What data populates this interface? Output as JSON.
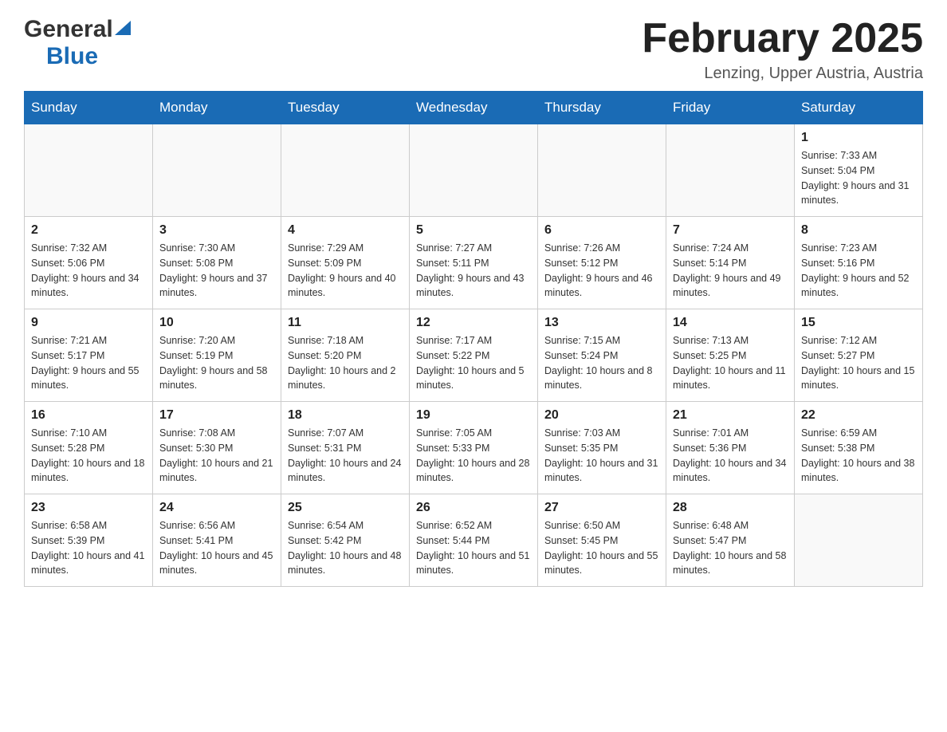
{
  "header": {
    "logo_general": "General",
    "logo_blue": "Blue",
    "month_title": "February 2025",
    "location": "Lenzing, Upper Austria, Austria"
  },
  "weekdays": [
    "Sunday",
    "Monday",
    "Tuesday",
    "Wednesday",
    "Thursday",
    "Friday",
    "Saturday"
  ],
  "weeks": [
    [
      {
        "day": "",
        "info": ""
      },
      {
        "day": "",
        "info": ""
      },
      {
        "day": "",
        "info": ""
      },
      {
        "day": "",
        "info": ""
      },
      {
        "day": "",
        "info": ""
      },
      {
        "day": "",
        "info": ""
      },
      {
        "day": "1",
        "info": "Sunrise: 7:33 AM\nSunset: 5:04 PM\nDaylight: 9 hours and 31 minutes."
      }
    ],
    [
      {
        "day": "2",
        "info": "Sunrise: 7:32 AM\nSunset: 5:06 PM\nDaylight: 9 hours and 34 minutes."
      },
      {
        "day": "3",
        "info": "Sunrise: 7:30 AM\nSunset: 5:08 PM\nDaylight: 9 hours and 37 minutes."
      },
      {
        "day": "4",
        "info": "Sunrise: 7:29 AM\nSunset: 5:09 PM\nDaylight: 9 hours and 40 minutes."
      },
      {
        "day": "5",
        "info": "Sunrise: 7:27 AM\nSunset: 5:11 PM\nDaylight: 9 hours and 43 minutes."
      },
      {
        "day": "6",
        "info": "Sunrise: 7:26 AM\nSunset: 5:12 PM\nDaylight: 9 hours and 46 minutes."
      },
      {
        "day": "7",
        "info": "Sunrise: 7:24 AM\nSunset: 5:14 PM\nDaylight: 9 hours and 49 minutes."
      },
      {
        "day": "8",
        "info": "Sunrise: 7:23 AM\nSunset: 5:16 PM\nDaylight: 9 hours and 52 minutes."
      }
    ],
    [
      {
        "day": "9",
        "info": "Sunrise: 7:21 AM\nSunset: 5:17 PM\nDaylight: 9 hours and 55 minutes."
      },
      {
        "day": "10",
        "info": "Sunrise: 7:20 AM\nSunset: 5:19 PM\nDaylight: 9 hours and 58 minutes."
      },
      {
        "day": "11",
        "info": "Sunrise: 7:18 AM\nSunset: 5:20 PM\nDaylight: 10 hours and 2 minutes."
      },
      {
        "day": "12",
        "info": "Sunrise: 7:17 AM\nSunset: 5:22 PM\nDaylight: 10 hours and 5 minutes."
      },
      {
        "day": "13",
        "info": "Sunrise: 7:15 AM\nSunset: 5:24 PM\nDaylight: 10 hours and 8 minutes."
      },
      {
        "day": "14",
        "info": "Sunrise: 7:13 AM\nSunset: 5:25 PM\nDaylight: 10 hours and 11 minutes."
      },
      {
        "day": "15",
        "info": "Sunrise: 7:12 AM\nSunset: 5:27 PM\nDaylight: 10 hours and 15 minutes."
      }
    ],
    [
      {
        "day": "16",
        "info": "Sunrise: 7:10 AM\nSunset: 5:28 PM\nDaylight: 10 hours and 18 minutes."
      },
      {
        "day": "17",
        "info": "Sunrise: 7:08 AM\nSunset: 5:30 PM\nDaylight: 10 hours and 21 minutes."
      },
      {
        "day": "18",
        "info": "Sunrise: 7:07 AM\nSunset: 5:31 PM\nDaylight: 10 hours and 24 minutes."
      },
      {
        "day": "19",
        "info": "Sunrise: 7:05 AM\nSunset: 5:33 PM\nDaylight: 10 hours and 28 minutes."
      },
      {
        "day": "20",
        "info": "Sunrise: 7:03 AM\nSunset: 5:35 PM\nDaylight: 10 hours and 31 minutes."
      },
      {
        "day": "21",
        "info": "Sunrise: 7:01 AM\nSunset: 5:36 PM\nDaylight: 10 hours and 34 minutes."
      },
      {
        "day": "22",
        "info": "Sunrise: 6:59 AM\nSunset: 5:38 PM\nDaylight: 10 hours and 38 minutes."
      }
    ],
    [
      {
        "day": "23",
        "info": "Sunrise: 6:58 AM\nSunset: 5:39 PM\nDaylight: 10 hours and 41 minutes."
      },
      {
        "day": "24",
        "info": "Sunrise: 6:56 AM\nSunset: 5:41 PM\nDaylight: 10 hours and 45 minutes."
      },
      {
        "day": "25",
        "info": "Sunrise: 6:54 AM\nSunset: 5:42 PM\nDaylight: 10 hours and 48 minutes."
      },
      {
        "day": "26",
        "info": "Sunrise: 6:52 AM\nSunset: 5:44 PM\nDaylight: 10 hours and 51 minutes."
      },
      {
        "day": "27",
        "info": "Sunrise: 6:50 AM\nSunset: 5:45 PM\nDaylight: 10 hours and 55 minutes."
      },
      {
        "day": "28",
        "info": "Sunrise: 6:48 AM\nSunset: 5:47 PM\nDaylight: 10 hours and 58 minutes."
      },
      {
        "day": "",
        "info": ""
      }
    ]
  ]
}
